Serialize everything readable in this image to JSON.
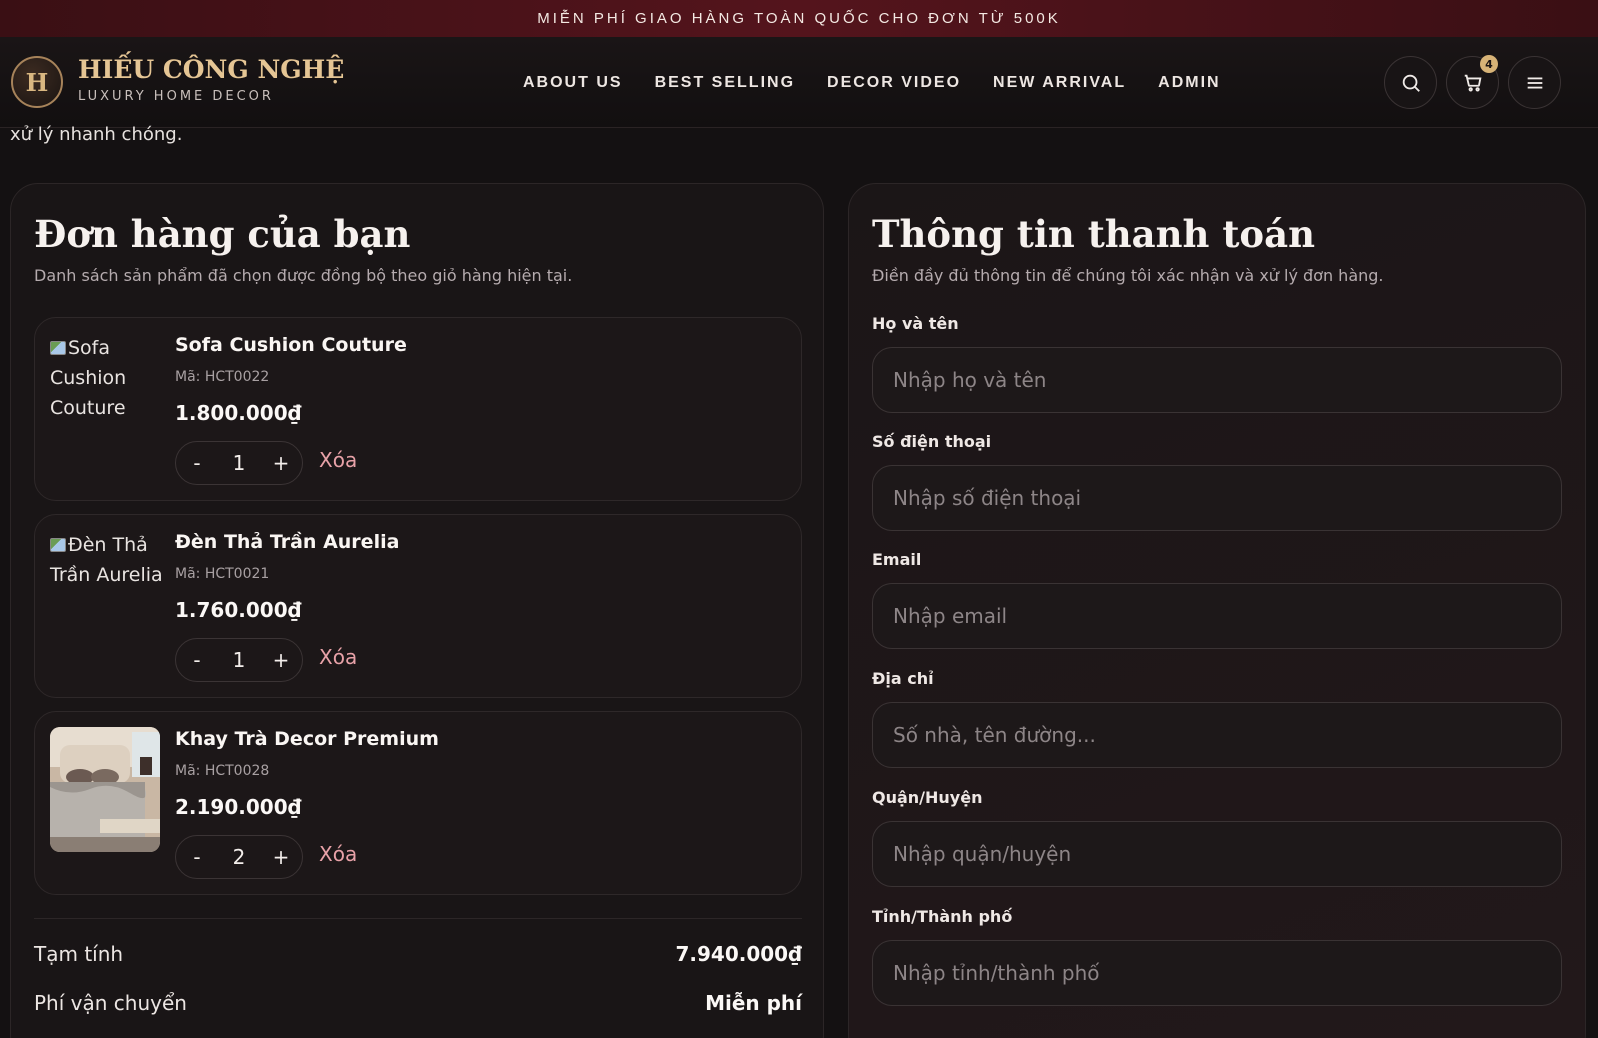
{
  "promo": {
    "text": "MIỄN PHÍ GIAO HÀNG TOÀN QUỐC CHO ĐƠN TỪ 500K"
  },
  "brand": {
    "badge_letter": "H",
    "name": "HIẾU CÔNG NGHỆ",
    "tagline": "LUXURY HOME DECOR"
  },
  "nav": {
    "items": [
      "ABOUT US",
      "BEST SELLING",
      "DECOR VIDEO",
      "NEW ARRIVAL",
      "ADMIN"
    ]
  },
  "header_actions": {
    "search_icon": "search-icon",
    "cart_icon": "cart-icon",
    "cart_count": "4",
    "menu_icon": "menu-icon"
  },
  "intro_text": "xử lý nhanh chóng.",
  "order": {
    "title": "Đơn hàng của bạn",
    "subtitle": "Danh sách sản phẩm đã chọn được đồng bộ theo giỏ hàng hiện tại.",
    "items": [
      {
        "image_alt": "Sofa Cushion Couture",
        "name": "Sofa Cushion Couture",
        "sku": "Mã: HCT0022",
        "price": "1.800.000₫",
        "qty": "1",
        "remove_label": "Xóa"
      },
      {
        "image_alt": "Đèn Thả Trần Aurelia",
        "name": "Đèn Thả Trần Aurelia",
        "sku": "Mã: HCT0021",
        "price": "1.760.000₫",
        "qty": "1",
        "remove_label": "Xóa"
      },
      {
        "image_alt": "",
        "name": "Khay Trà Decor Premium",
        "sku": "Mã: HCT0028",
        "price": "2.190.000₫",
        "qty": "2",
        "remove_label": "Xóa"
      }
    ],
    "qty_minus": "-",
    "qty_plus": "+",
    "subtotal_label": "Tạm tính",
    "subtotal_value": "7.940.000₫",
    "shipping_label": "Phí vận chuyển",
    "shipping_value": "Miễn phí"
  },
  "checkout": {
    "title": "Thông tin thanh toán",
    "subtitle": "Điền đầy đủ thông tin để chúng tôi xác nhận và xử lý đơn hàng.",
    "fields": [
      {
        "label": "Họ và tên",
        "placeholder": "Nhập họ và tên"
      },
      {
        "label": "Số điện thoại",
        "placeholder": "Nhập số điện thoại"
      },
      {
        "label": "Email",
        "placeholder": "Nhập email"
      },
      {
        "label": "Địa chỉ",
        "placeholder": "Số nhà, tên đường..."
      },
      {
        "label": "Quận/Huyện",
        "placeholder": "Nhập quận/huyện"
      },
      {
        "label": "Tỉnh/Thành phố",
        "placeholder": "Nhập tỉnh/thành phố"
      }
    ]
  },
  "colors": {
    "accent_gold": "#d7b377",
    "remove_pink": "#e8a2a8",
    "promo_bg": "#54141c",
    "page_bg": "#141112"
  }
}
